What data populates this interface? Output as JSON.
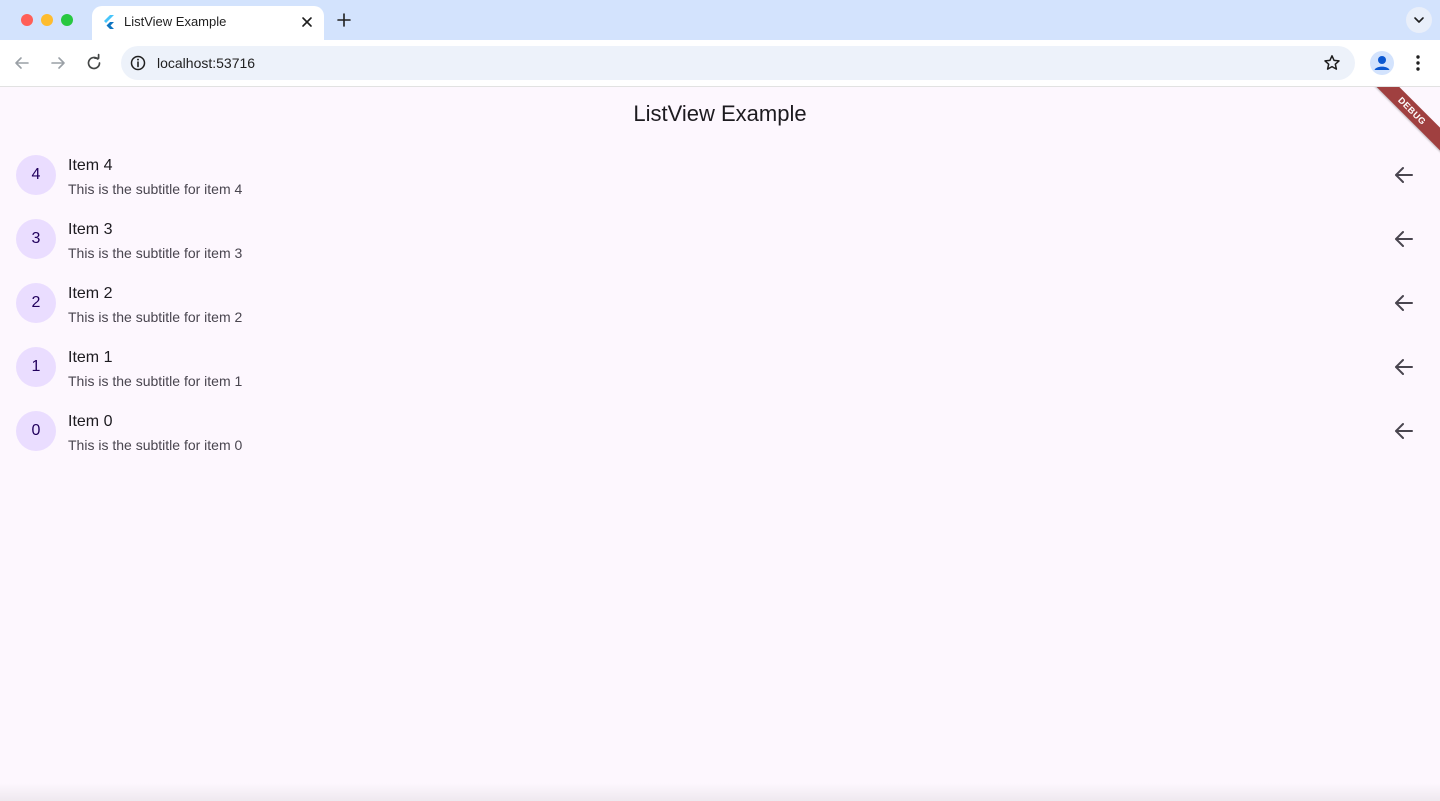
{
  "browser": {
    "tab_title": "ListView Example",
    "tab_favicon": "flutter-logo-icon",
    "url": "localhost:53716"
  },
  "app": {
    "title": "ListView Example",
    "debug_banner": "DEBUG",
    "items": [
      {
        "avatar": "4",
        "title": "Item 4",
        "subtitle": "This is the subtitle for item 4",
        "trailing_icon": "arrow-back-icon"
      },
      {
        "avatar": "3",
        "title": "Item 3",
        "subtitle": "This is the subtitle for item 3",
        "trailing_icon": "arrow-back-icon"
      },
      {
        "avatar": "2",
        "title": "Item 2",
        "subtitle": "This is the subtitle for item 2",
        "trailing_icon": "arrow-back-icon"
      },
      {
        "avatar": "1",
        "title": "Item 1",
        "subtitle": "This is the subtitle for item 1",
        "trailing_icon": "arrow-back-icon"
      },
      {
        "avatar": "0",
        "title": "Item 0",
        "subtitle": "This is the subtitle for item 0",
        "trailing_icon": "arrow-back-icon"
      }
    ]
  },
  "colors": {
    "tabbar_bg": "#d3e3fd",
    "page_bg": "#fdf7fe",
    "avatar_bg": "#eaddff",
    "avatar_text": "#21005d",
    "debug_banner": "#a04040"
  }
}
